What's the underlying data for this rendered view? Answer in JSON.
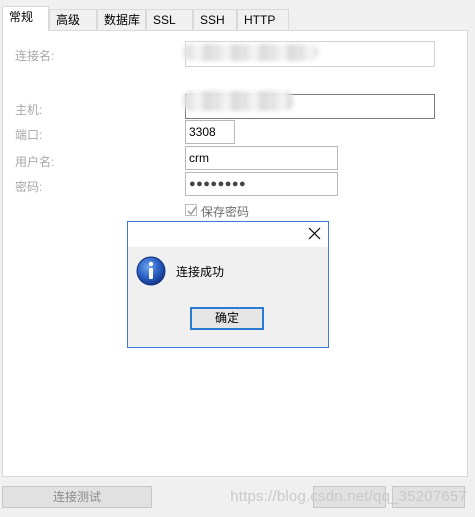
{
  "tabs": [
    {
      "label": "常规"
    },
    {
      "label": "高级"
    },
    {
      "label": "数据库"
    },
    {
      "label": "SSL"
    },
    {
      "label": "SSH"
    },
    {
      "label": "HTTP"
    }
  ],
  "form": {
    "connection_name_label": "连接名:",
    "host_label": "主机:",
    "port_label": "端口:",
    "port_value": "3308",
    "username_label": "用户名:",
    "username_value": "crm",
    "password_label": "密码:",
    "password_value": "●●●●●●●●",
    "save_password_label": "保存密码",
    "save_password_checked": true
  },
  "dialog": {
    "message": "连接成功",
    "ok_label": "确定",
    "icon": "info-icon",
    "accent": "#3b7bd6"
  },
  "footer": {
    "test_connection_label": "连接测试",
    "watermark": "https://blog.csdn.net/qq_35207657"
  }
}
